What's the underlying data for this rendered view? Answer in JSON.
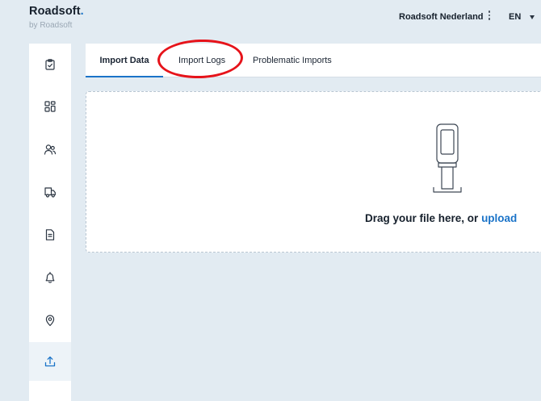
{
  "brand": {
    "name": "Roadsoft",
    "dot": ".",
    "subtitle": "by Roadsoft"
  },
  "header": {
    "organization": "Roadsoft Nederland",
    "language": "EN"
  },
  "sidebar": {
    "items": [
      {
        "icon": "clipboard-check-icon",
        "active": false
      },
      {
        "icon": "dashboard-grid-icon",
        "active": false
      },
      {
        "icon": "users-icon",
        "active": false
      },
      {
        "icon": "truck-icon",
        "active": false
      },
      {
        "icon": "document-icon",
        "active": false
      },
      {
        "icon": "bell-icon",
        "active": false
      },
      {
        "icon": "location-pin-icon",
        "active": false
      },
      {
        "icon": "upload-icon",
        "active": true
      }
    ]
  },
  "tabs": [
    {
      "label": "Import Data",
      "active": true
    },
    {
      "label": "Import Logs",
      "active": false,
      "highlighted": true
    },
    {
      "label": "Problematic Imports",
      "active": false
    }
  ],
  "dropzone": {
    "prompt": "Drag your file here, or",
    "upload_label": "upload",
    "icon": "file-scanner-icon"
  },
  "colors": {
    "accent": "#1a73c8",
    "background": "#e2ebf2",
    "annotation": "#e6131a"
  }
}
